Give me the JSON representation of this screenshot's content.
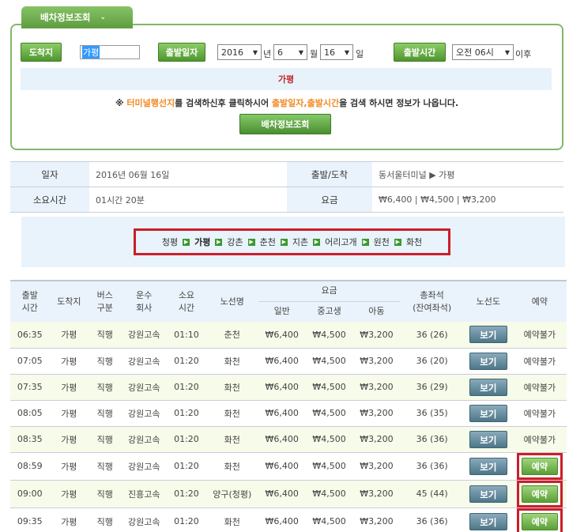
{
  "panel": {
    "tab_label": "배차정보조회",
    "tab_chevron": "chevron-down-icon",
    "dest_label": "도착지",
    "dest_value": "가평",
    "date_label": "출발일자",
    "year": "2016",
    "year_unit": "년",
    "month": "6",
    "month_unit": "월",
    "day": "16",
    "day_unit": "일",
    "time_label": "출발시간",
    "time_value": "오전 06시",
    "time_suffix": "이후",
    "dest_display": "가평",
    "notice_prefix": "※ ",
    "notice_hl1": "터미널행선지",
    "notice_mid1": "를 검색하신후 클릭하시어 ",
    "notice_hl2": "출발일자,출발시간",
    "notice_end": "을 검색 하시면 정보가 나옵니다.",
    "search_button": "배차정보조회"
  },
  "summary": {
    "date_label": "일자",
    "date_value": "2016년 06월 16일",
    "route_label": "출발/도착",
    "route_value": "동서울터미널 ▶ 가평",
    "duration_label": "소요시간",
    "duration_value": "01시간 20분",
    "fare_label": "요금",
    "fare_value": "₩6,400 | ₩4,500 | ₩3,200"
  },
  "route": {
    "stops": [
      "청평",
      "가평",
      "강촌",
      "춘천",
      "지촌",
      "어리고개",
      "원천",
      "화천"
    ],
    "current": "가평",
    "arrow_icon": "arrow-right-icon"
  },
  "schedule": {
    "headers": {
      "depart": "출발\n시간",
      "dest": "도착지",
      "bus_type": "버스\n구분",
      "company": "운수\n회사",
      "duration": "소요\n시간",
      "line": "노선명",
      "fare": "요금",
      "fare_adult": "일반",
      "fare_youth": "중고생",
      "fare_child": "아동",
      "seats": "총좌석\n(잔여좌석)",
      "map": "노선도",
      "reserve": "예약"
    },
    "view_label": "보기",
    "rows": [
      {
        "time": "06:35",
        "dest": "가평",
        "type": "직행",
        "company": "강원고속",
        "dur": "01:10",
        "line": "춘천",
        "adult": "₩6,400",
        "youth": "₩4,500",
        "child": "₩3,200",
        "seats": "36 (26)",
        "reserve": "예약불가",
        "can_reserve": false
      },
      {
        "time": "07:05",
        "dest": "가평",
        "type": "직행",
        "company": "강원고속",
        "dur": "01:20",
        "line": "화천",
        "adult": "₩6,400",
        "youth": "₩4,500",
        "child": "₩3,200",
        "seats": "36 (20)",
        "reserve": "예약불가",
        "can_reserve": false
      },
      {
        "time": "07:35",
        "dest": "가평",
        "type": "직행",
        "company": "강원고속",
        "dur": "01:20",
        "line": "화천",
        "adult": "₩6,400",
        "youth": "₩4,500",
        "child": "₩3,200",
        "seats": "36 (29)",
        "reserve": "예약불가",
        "can_reserve": false
      },
      {
        "time": "08:05",
        "dest": "가평",
        "type": "직행",
        "company": "강원고속",
        "dur": "01:20",
        "line": "화천",
        "adult": "₩6,400",
        "youth": "₩4,500",
        "child": "₩3,200",
        "seats": "36 (35)",
        "reserve": "예약불가",
        "can_reserve": false
      },
      {
        "time": "08:35",
        "dest": "가평",
        "type": "직행",
        "company": "강원고속",
        "dur": "01:20",
        "line": "화천",
        "adult": "₩6,400",
        "youth": "₩4,500",
        "child": "₩3,200",
        "seats": "36 (36)",
        "reserve": "예약불가",
        "can_reserve": false
      },
      {
        "time": "08:59",
        "dest": "가평",
        "type": "직행",
        "company": "강원고속",
        "dur": "01:20",
        "line": "화천",
        "adult": "₩6,400",
        "youth": "₩4,500",
        "child": "₩3,200",
        "seats": "36 (36)",
        "reserve": "예약",
        "can_reserve": true
      },
      {
        "time": "09:00",
        "dest": "가평",
        "type": "직행",
        "company": "진흥고속",
        "dur": "01:20",
        "line": "양구(청평)",
        "adult": "₩6,400",
        "youth": "₩4,500",
        "child": "₩3,200",
        "seats": "45 (44)",
        "reserve": "예약",
        "can_reserve": true
      },
      {
        "time": "09:35",
        "dest": "가평",
        "type": "직행",
        "company": "강원고속",
        "dur": "01:20",
        "line": "화천",
        "adult": "₩6,400",
        "youth": "₩4,500",
        "child": "₩3,200",
        "seats": "36 (36)",
        "reserve": "예약",
        "can_reserve": true
      }
    ]
  },
  "colors": {
    "accent_green": "#5e9d3f",
    "highlight_red": "#cc1d2a",
    "header_bg": "#eaf3fb",
    "notice_orange": "#f08a24"
  }
}
